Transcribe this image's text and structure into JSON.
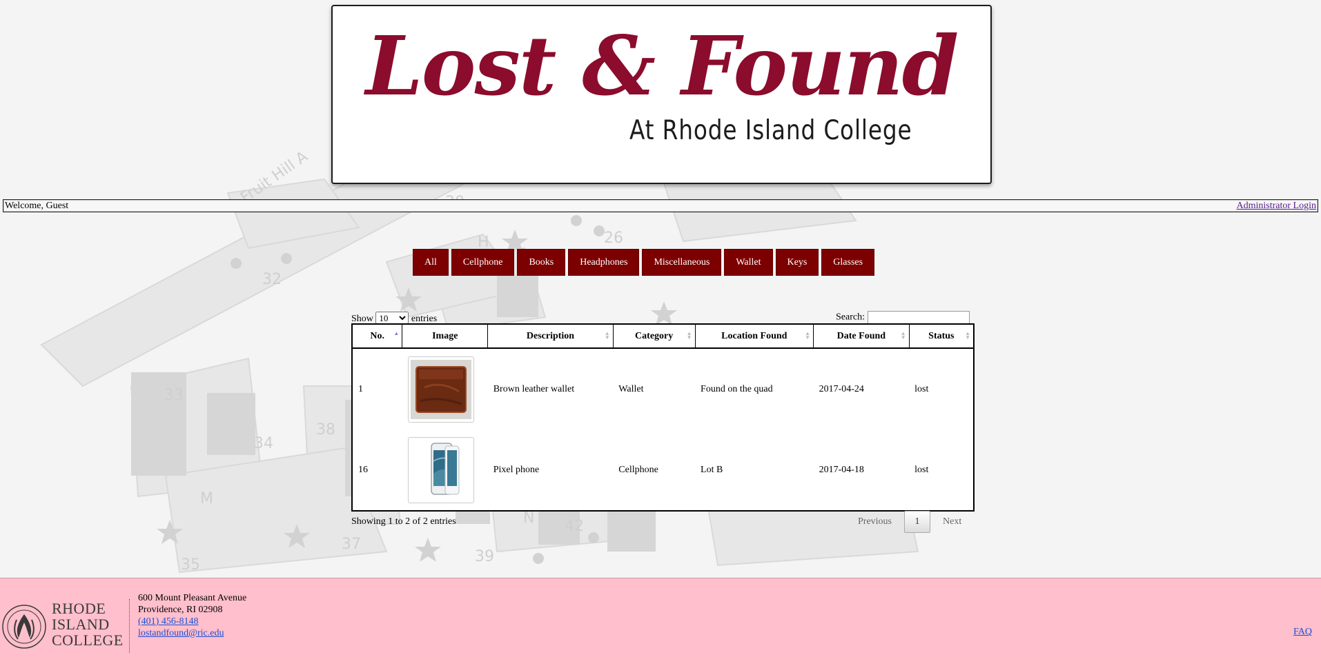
{
  "banner": {
    "title": "Lost & Found",
    "subtitle": "At Rhode Island College"
  },
  "welcome": {
    "text": "Welcome, Guest",
    "admin_link": "Administrator Login"
  },
  "filters": [
    "All",
    "Cellphone",
    "Books",
    "Headphones",
    "Miscellaneous",
    "Wallet",
    "Keys",
    "Glasses"
  ],
  "controls": {
    "show_label": "Show",
    "entries_label": "entries",
    "page_size": "10",
    "search_label": "Search:",
    "search_value": ""
  },
  "table": {
    "columns": [
      "No.",
      "Image",
      "Description",
      "Category",
      "Location Found",
      "Date Found",
      "Status"
    ],
    "rows": [
      {
        "no": "1",
        "image": "wallet-image",
        "description": "Brown leather wallet",
        "category": "Wallet",
        "location": "Found on the quad",
        "date": "2017-04-24",
        "status": "lost"
      },
      {
        "no": "16",
        "image": "phone-image",
        "description": "Pixel phone",
        "category": "Cellphone",
        "location": "Lot B",
        "date": "2017-04-18",
        "status": "lost"
      }
    ]
  },
  "info": "Showing 1 to 2 of 2 entries",
  "pager": {
    "previous": "Previous",
    "current": "1",
    "next": "Next"
  },
  "footer": {
    "college_name": [
      "RHODE",
      "ISLAND",
      "COLLEGE"
    ],
    "address1": "600 Mount Pleasant Avenue",
    "address2": "Providence, RI 02908",
    "phone": "(401) 456-8148",
    "email": "lostandfound@ric.edu",
    "faq": "FAQ"
  },
  "map_labels": [
    "Fruit Hill A",
    "30",
    "26",
    "32",
    "33",
    "34",
    "38",
    "35",
    "37",
    "39",
    "42",
    "M",
    "N",
    "H"
  ],
  "colors": {
    "accent": "#7d0000",
    "logo": "#8b0c2c",
    "footer_bg": "#ffbfcc",
    "link": "#1a4fd6"
  }
}
